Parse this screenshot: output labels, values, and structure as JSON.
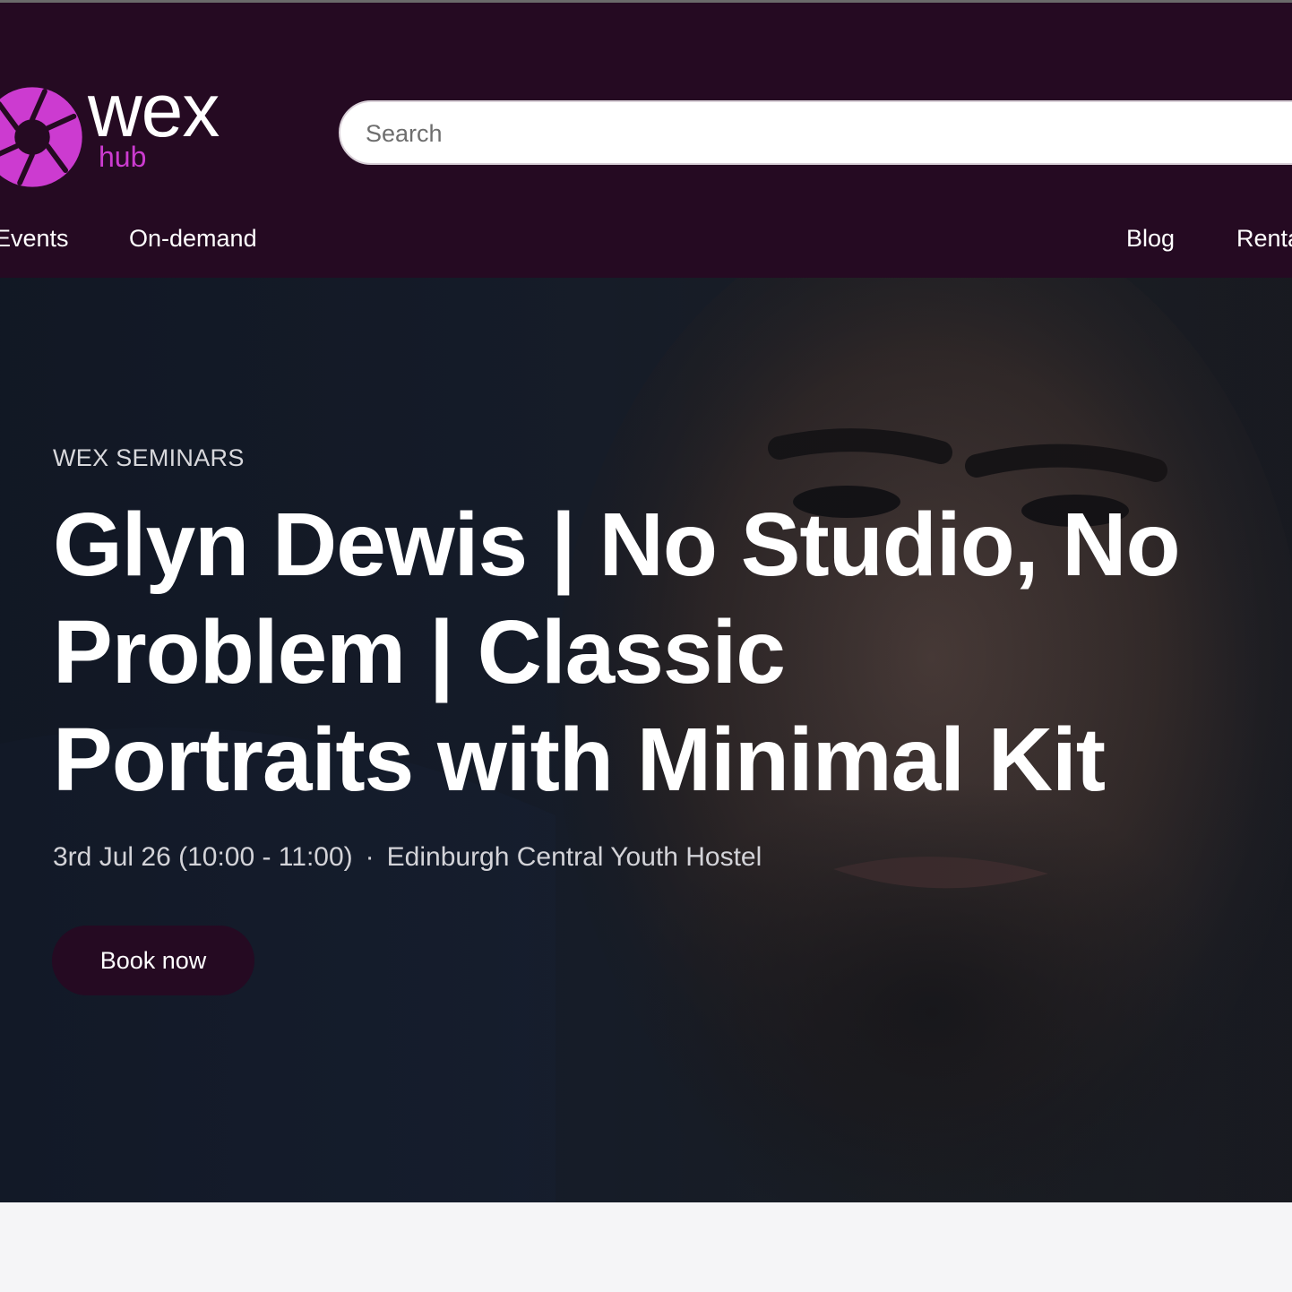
{
  "brand": {
    "name": "wex",
    "sub": "hub",
    "primary_color": "#250a22",
    "accent_color": "#cc3bd0"
  },
  "search": {
    "placeholder": "Search"
  },
  "nav": {
    "events": "Events",
    "on_demand": "On-demand",
    "blog": "Blog",
    "rentals": "Rentals"
  },
  "hero": {
    "eyebrow": "WEX SEMINARS",
    "title_lines": [
      "Glyn Dewis | No Studio, No",
      "Problem | Classic",
      "Portraits with Minimal Kit"
    ],
    "date_time": "3rd Jul 26 (10:00 - 11:00)",
    "separator": "·",
    "location": "Edinburgh Central Youth Hostel",
    "cta_label": "Book now"
  }
}
